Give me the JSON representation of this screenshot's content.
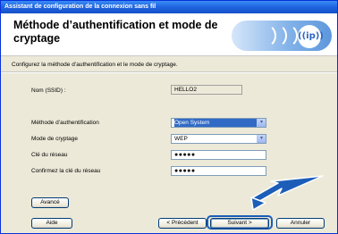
{
  "window": {
    "title": "Assistant de configuration de la connexion sans fil"
  },
  "header": {
    "title": "Méthode d’authentification et mode de cryptage",
    "logo_text": "((ip))"
  },
  "subtitle": "Configurez la méthode d’authentification et le mode de cryptage.",
  "form": {
    "ssid_label": "Nom (SSID) :",
    "ssid_value": "HELLO2",
    "auth_label": "Méthode d’authentification",
    "auth_value": "Open System",
    "enc_label": "Mode de cryptage",
    "enc_value": "WEP",
    "key_label": "Clé du réseau",
    "key_value": "●●●●●",
    "confirm_label": "Confirmez la clé du réseau",
    "confirm_value": "●●●●●"
  },
  "buttons": {
    "advanced": "Avancé",
    "help": "Aide",
    "back": "< Précédent",
    "next": "Suivant >",
    "cancel": "Annuler"
  },
  "colors": {
    "titlebar": "#1f64df",
    "selection": "#316ac5",
    "arrow": "#1c5db8"
  },
  "icons": {
    "dropdown": "chevron-down-icon",
    "logo": "wireless-ip-logo",
    "pointer": "arrow-pointer-icon"
  }
}
